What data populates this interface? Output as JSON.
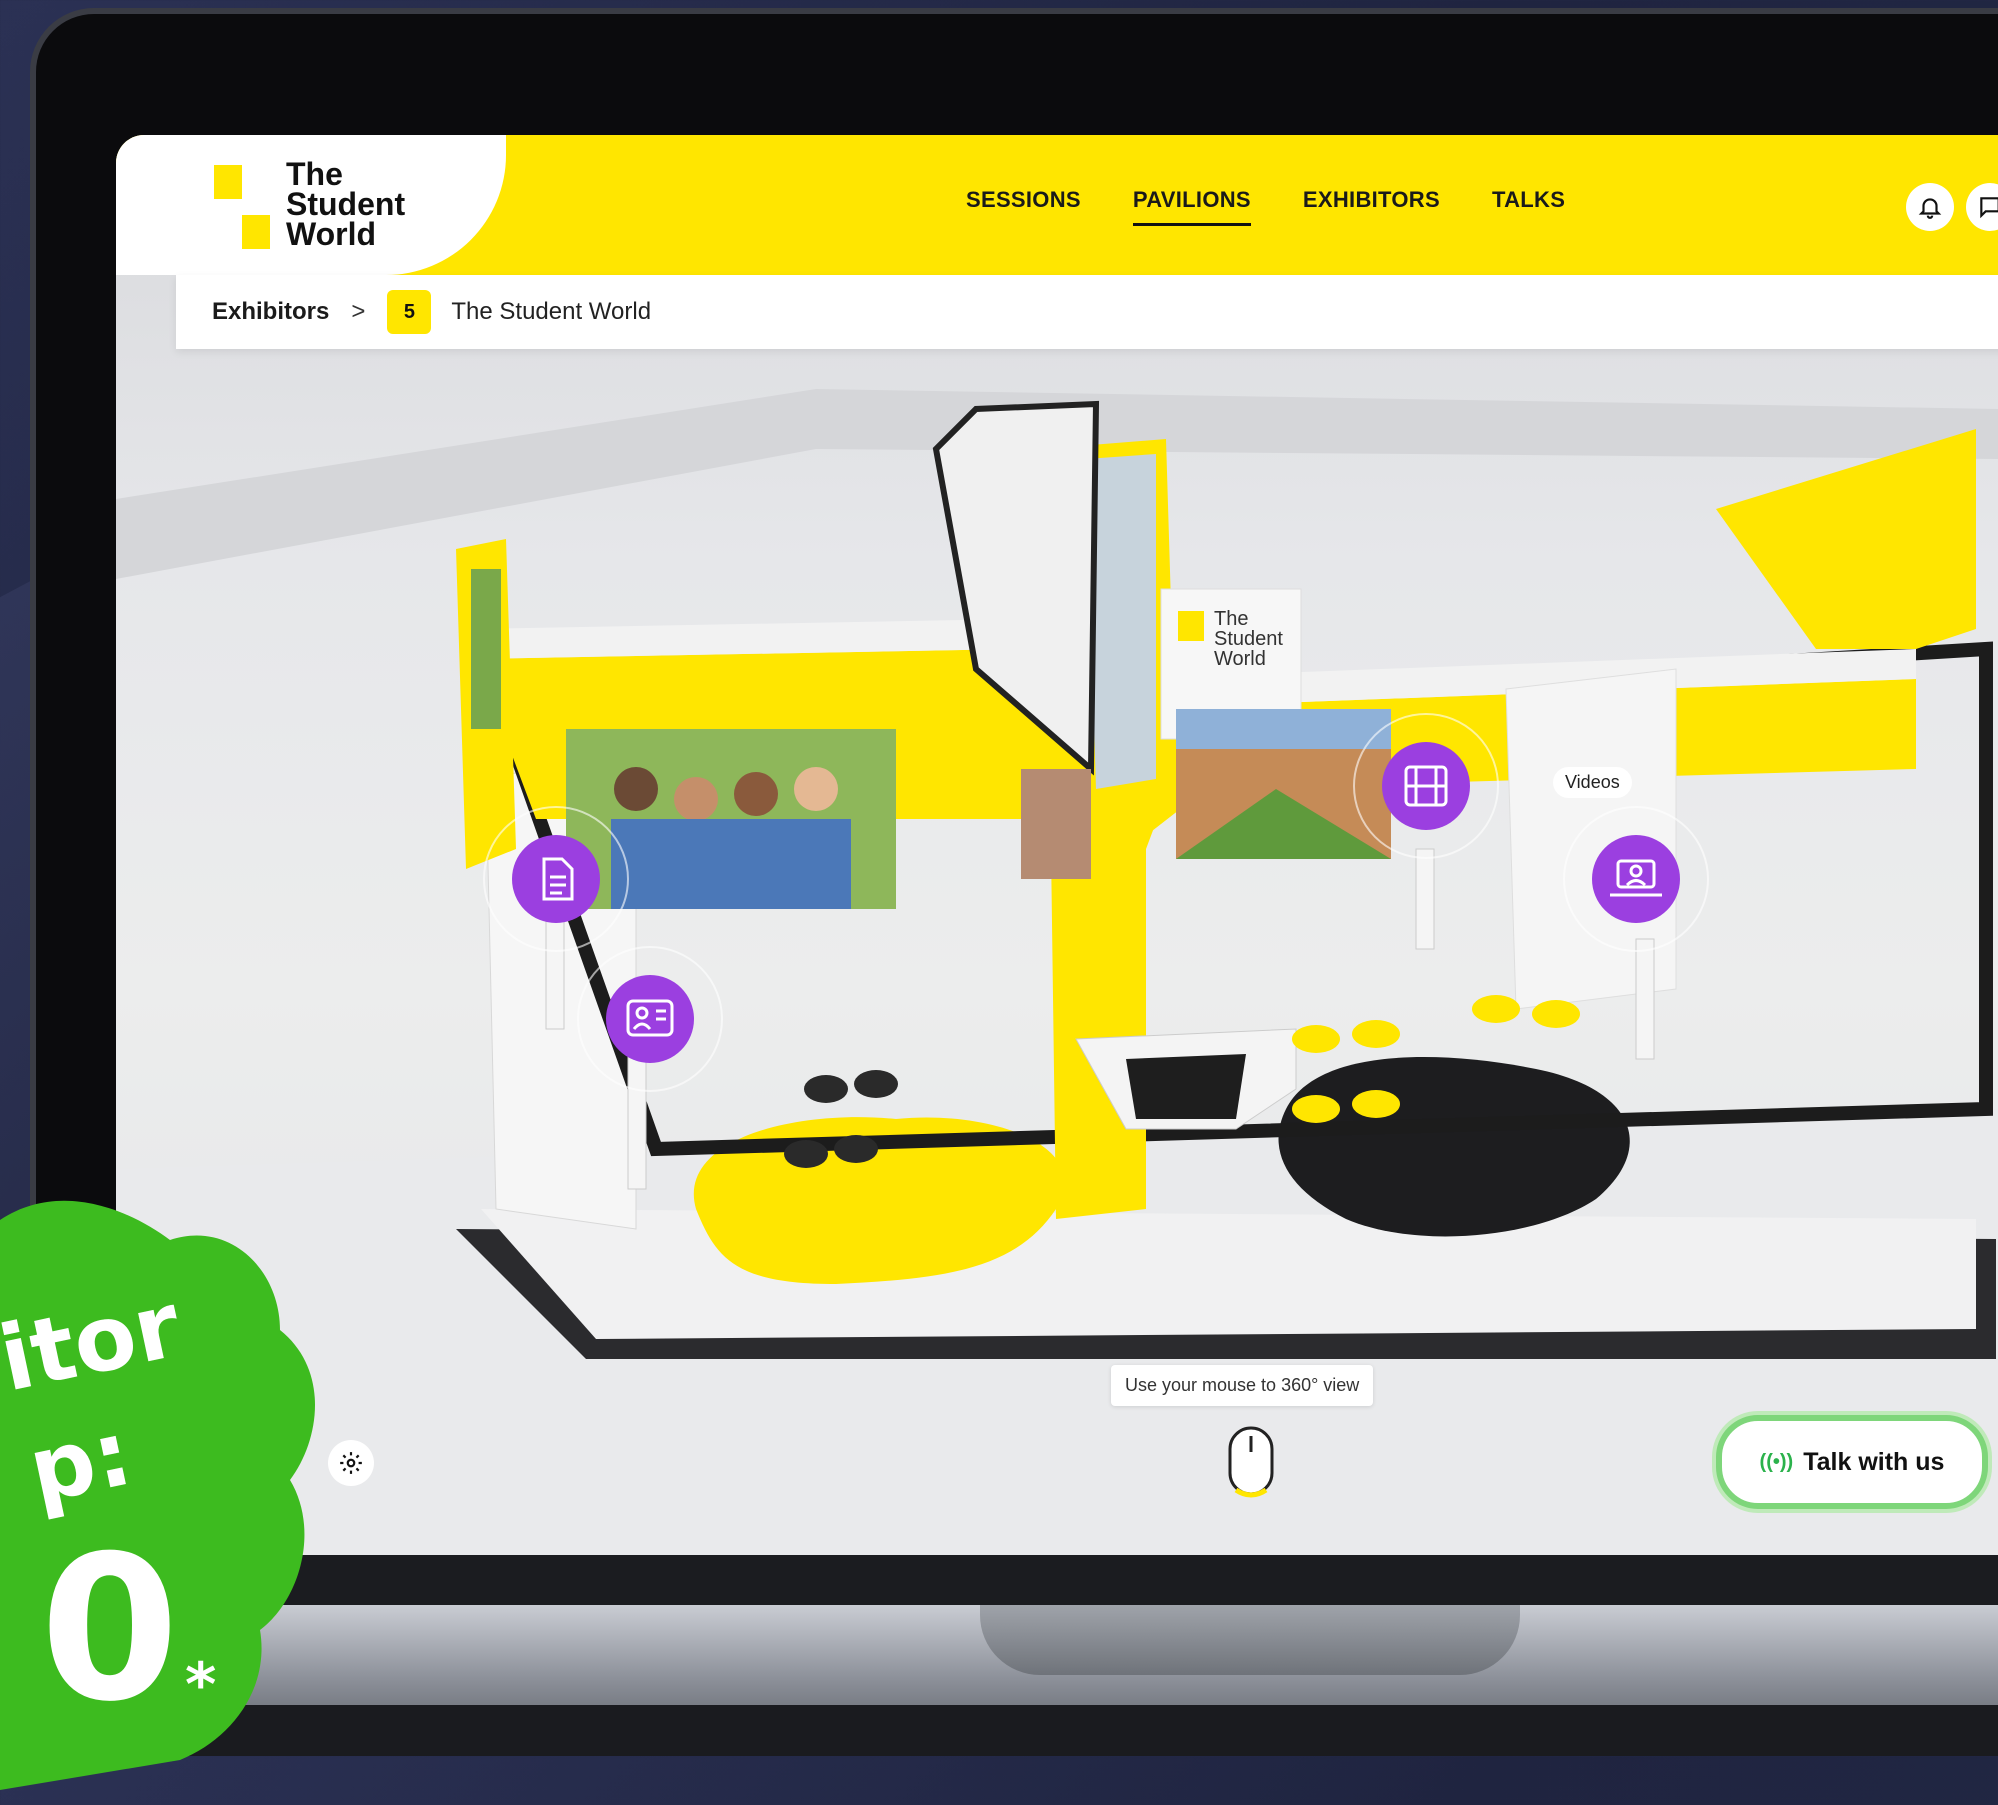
{
  "brand": {
    "line1": "The",
    "line2": "Student",
    "line3": "World",
    "mark_glyph": "5"
  },
  "nav": {
    "items": [
      "SESSIONS",
      "PAVILIONS",
      "EXHIBITORS",
      "TALKS"
    ],
    "active": "PAVILIONS"
  },
  "header_icons": [
    "bell-icon",
    "chat-icon"
  ],
  "breadcrumb": {
    "parent": "Exhibitors",
    "separator": ">",
    "current": "The Student World"
  },
  "booth": {
    "sign": {
      "line1": "The",
      "line2": "Student",
      "line3": "World"
    },
    "hotspots": [
      {
        "name": "document-hotspot",
        "icon": "document-icon"
      },
      {
        "name": "contact-card-hotspot",
        "icon": "contact-card-icon"
      },
      {
        "name": "videos-hotspot",
        "icon": "film-icon",
        "tooltip": "Videos"
      },
      {
        "name": "profile-laptop-hotspot",
        "icon": "laptop-user-icon"
      }
    ]
  },
  "hint": {
    "text": "Use your mouse to 360° view"
  },
  "cta": {
    "label": "Talk with us",
    "icon_glyph": "((•))"
  },
  "promo": {
    "line1": "itor",
    "line2": "p:",
    "line3": "0",
    "asterisk": "*"
  },
  "colors": {
    "brand_yellow": "#ffe600",
    "hotspot_purple": "#9b3fe0",
    "badge_green": "#3dbb1f",
    "talk_border": "#7ed67a"
  }
}
